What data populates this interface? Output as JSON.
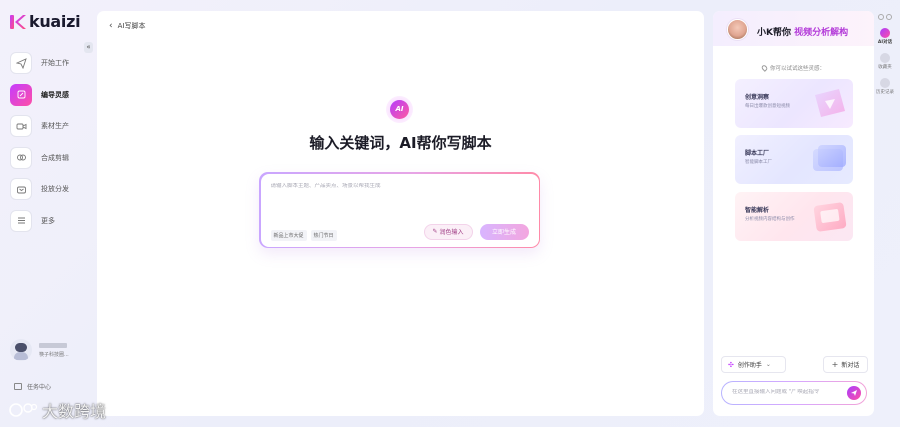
{
  "brand": {
    "name": "kuaizi"
  },
  "sidebar": {
    "items": [
      {
        "label": "开始工作",
        "icon": "paper-plane-icon",
        "active": false
      },
      {
        "label": "编导灵感",
        "icon": "pen-icon",
        "active": true
      },
      {
        "label": "素材生产",
        "icon": "video-icon",
        "active": false
      },
      {
        "label": "合成剪辑",
        "icon": "link-icon",
        "active": false
      },
      {
        "label": "投放分发",
        "icon": "share-icon",
        "active": false
      },
      {
        "label": "更多",
        "icon": "menu-icon",
        "active": false
      }
    ],
    "user": {
      "subtitle": "筷子科技圈..."
    },
    "task_center": "任务中心"
  },
  "watermark": {
    "text": "大数跨境"
  },
  "main": {
    "breadcrumb": "AI写脚本",
    "ai_badge": "AI",
    "headline": "输入关键词，AI帮你写脚本",
    "prompt": {
      "placeholder": "请输入脚本主题、产品卖点、场景以帮我生成",
      "value": "",
      "tags": [
        "新品上市大促",
        "热门节日"
      ],
      "secondary_action": "润色输入",
      "primary_action": "立即生成"
    }
  },
  "assistant": {
    "title_prefix": "小K帮你 ",
    "title_highlight": "视频分析解构",
    "hint": "你可以试试这些灵感：",
    "cards": [
      {
        "title": "创意洞察",
        "desc": "每日出爆款创意短视频"
      },
      {
        "title": "脚本工厂",
        "desc": "智能脚本工厂"
      },
      {
        "title": "智能解析",
        "desc": "分析视频内容结构与创作"
      }
    ],
    "helper_dropdown": "创作助手",
    "new_chat": "新对话",
    "chat_input": {
      "placeholder": "在这里直接输入问题或 \"/\" 唤起指令",
      "value": ""
    }
  },
  "rail": {
    "items": [
      {
        "label": "AI对话",
        "active": true
      },
      {
        "label": "收藏夹",
        "active": false
      },
      {
        "label": "历史记录",
        "active": false
      }
    ]
  },
  "colors": {
    "accent": "#b43cd9",
    "active_nav_gradient_start": "#c43cff",
    "active_nav_gradient_end": "#ff4fa6"
  }
}
